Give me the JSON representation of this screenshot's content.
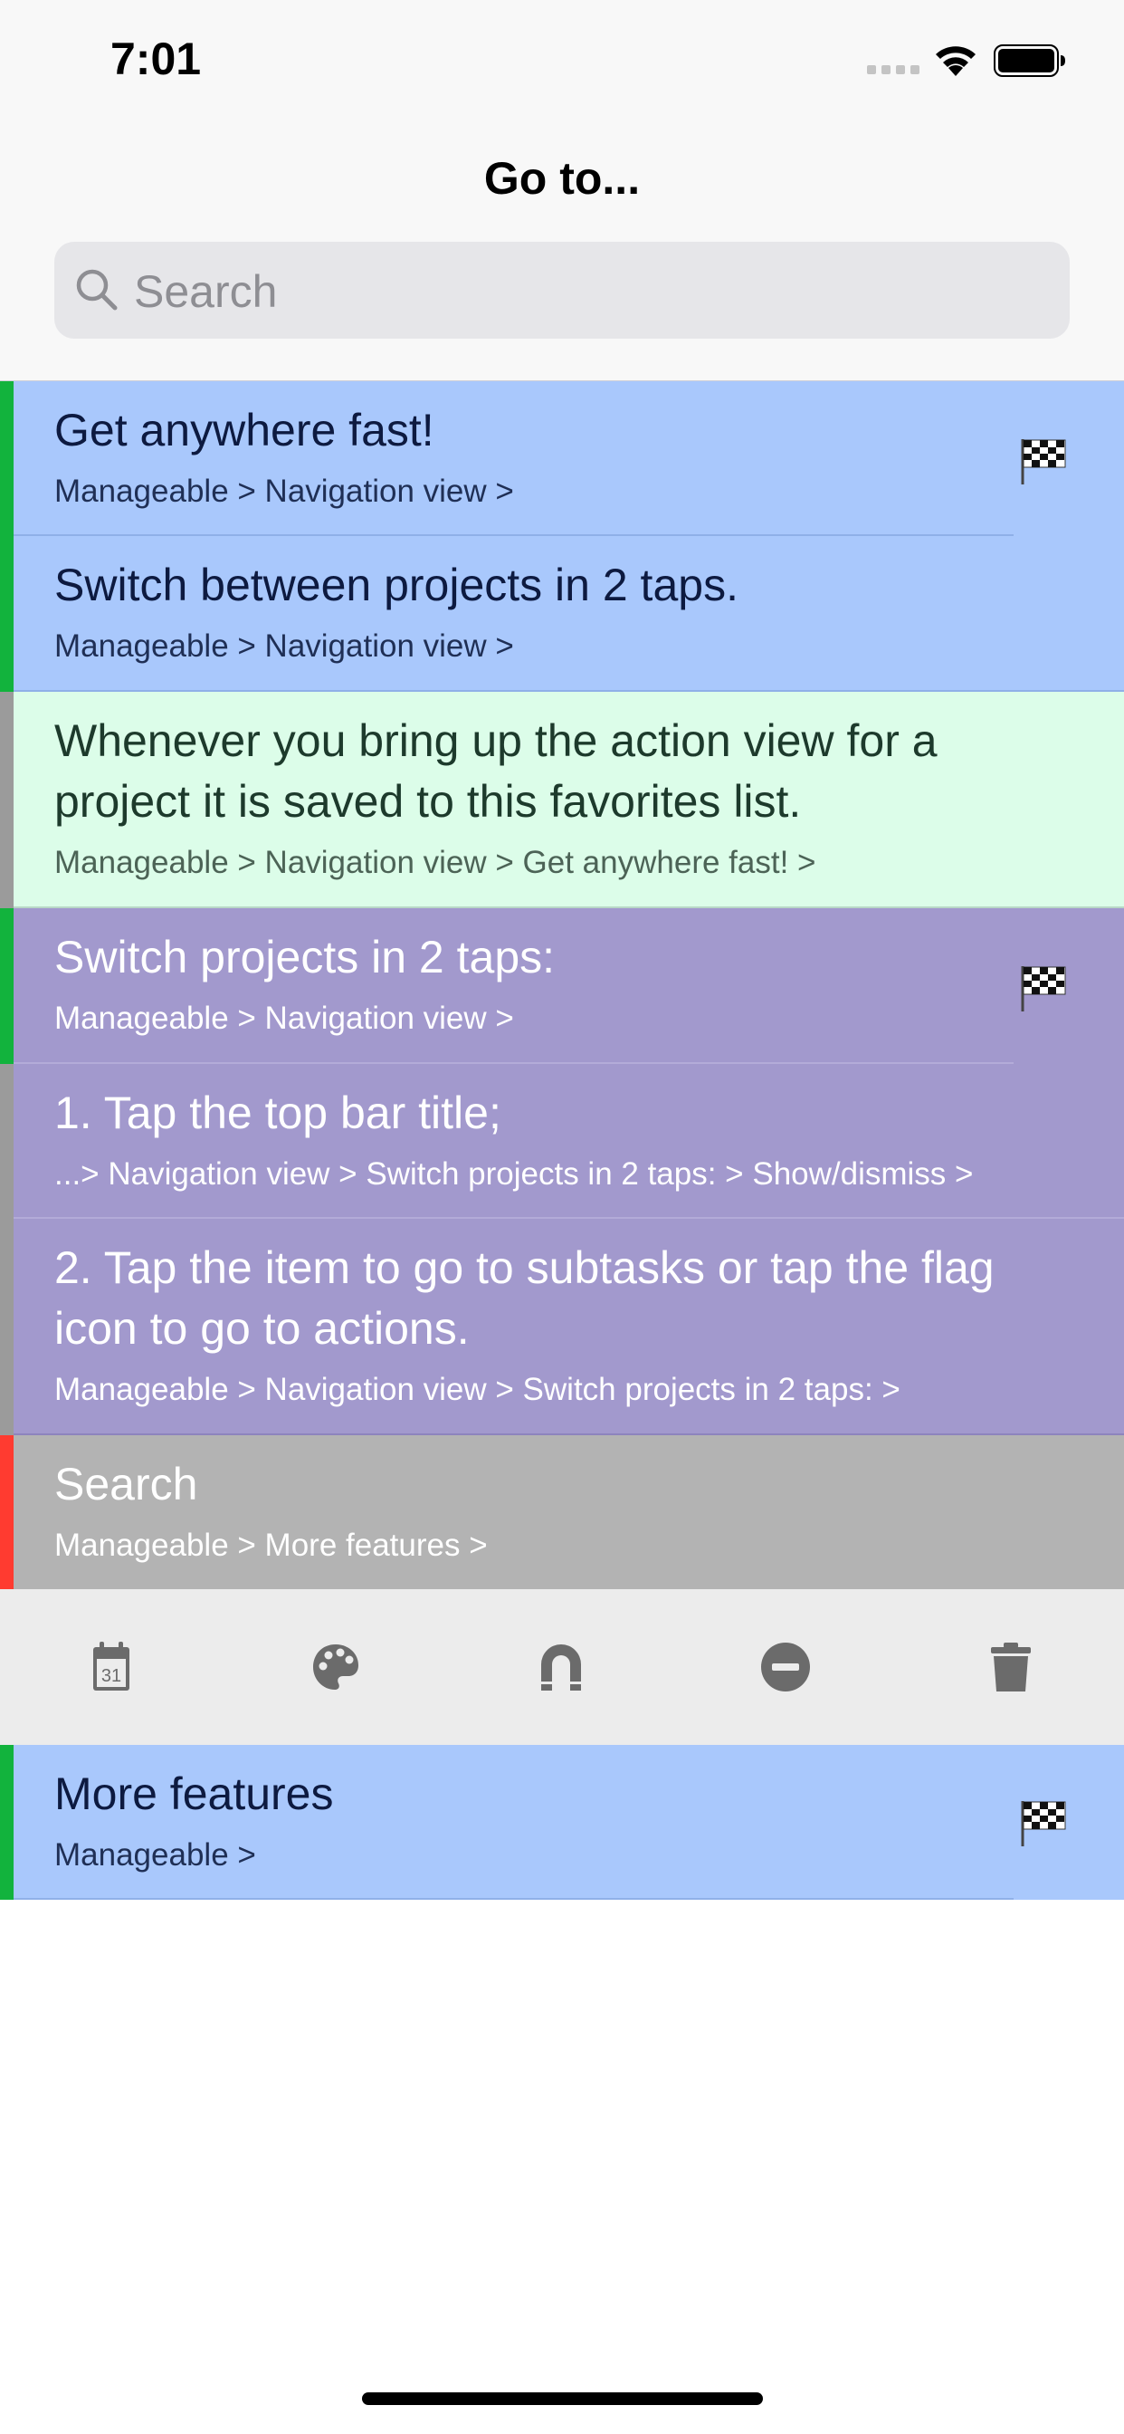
{
  "status_bar": {
    "time": "7:01"
  },
  "header": {
    "title": "Go to...",
    "search_placeholder": "Search"
  },
  "list_top": [
    {
      "title": "Get anywhere fast!",
      "path": "Manageable > Navigation view >",
      "flag": true
    },
    {
      "title": "Switch between projects in 2 taps.",
      "path": "Manageable > Navigation view >",
      "flag": false
    },
    {
      "title": "Whenever you bring up the action view for a project it is saved to this favorites list.",
      "path": "Manageable > Navigation view > Get anywhere fast! >",
      "flag": false
    },
    {
      "title": "Switch projects in 2 taps:",
      "path": "Manageable > Navigation view >",
      "flag": true
    },
    {
      "title": "1. Tap the top bar title;",
      "path": "...> Navigation view > Switch projects in 2 taps: > Show/dismiss >",
      "flag": false
    },
    {
      "title": "2. Tap the item to go to subtasks or tap the flag icon to go to actions.",
      "path": "Manageable > Navigation view > Switch projects in 2 taps: >",
      "flag": false
    },
    {
      "title": "Search",
      "path": "Manageable > More features >",
      "flag": false
    }
  ],
  "toolbar": {
    "icons": [
      "calendar-icon",
      "palette-icon",
      "magnet-icon",
      "minus-circle-icon",
      "trash-icon"
    ],
    "calendar_day": "31"
  },
  "list_bottom": [
    {
      "title": "More features",
      "path": "Manageable >",
      "flag": true
    }
  ],
  "colors": {
    "blue_row": "#a9c8fc",
    "mint_row": "#dcfde9",
    "purple_row": "#a299cd",
    "gray_row": "#b3b3b3",
    "stripe_green": "#12b33d",
    "stripe_gray": "#9b9b9b",
    "stripe_red": "#ff3b30",
    "toolbar_bg": "#ececec",
    "toolbar_icon": "#6b6b6b"
  }
}
